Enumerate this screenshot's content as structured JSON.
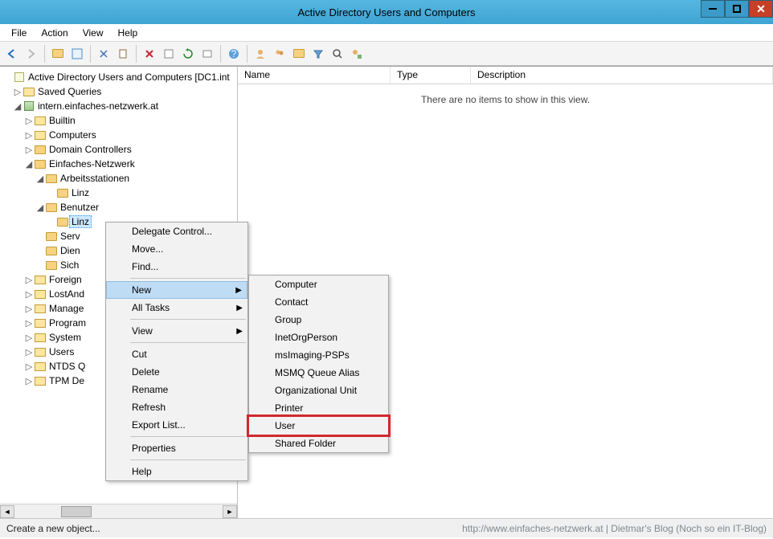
{
  "window": {
    "title": "Active Directory Users and Computers"
  },
  "menubar": {
    "file": "File",
    "action": "Action",
    "view": "View",
    "help": "Help"
  },
  "tree": {
    "root": "Active Directory Users and Computers [DC1.int",
    "saved": "Saved Queries",
    "domain": "intern.einfaches-netzwerk.at",
    "builtin": "Builtin",
    "computers": "Computers",
    "dc": "Domain Controllers",
    "en": "Einfaches-Netzwerk",
    "arbeit": "Arbeitsstationen",
    "linz1": "Linz",
    "benutzer": "Benutzer",
    "linz2": "Linz",
    "serv": "Serv",
    "dien": "Dien",
    "sich": "Sich",
    "foreign": "Foreign",
    "lost": "LostAnd",
    "manage": "Manage",
    "program": "Program",
    "system": "System",
    "users": "Users",
    "ntds": "NTDS Q",
    "tpm": "TPM De"
  },
  "list": {
    "col_name": "Name",
    "col_type": "Type",
    "col_desc": "Description",
    "empty": "There are no items to show in this view."
  },
  "context_menu": {
    "delegate": "Delegate Control...",
    "move": "Move...",
    "find": "Find...",
    "new": "New",
    "alltasks": "All Tasks",
    "view": "View",
    "cut": "Cut",
    "delete": "Delete",
    "rename": "Rename",
    "refresh": "Refresh",
    "export": "Export List...",
    "properties": "Properties",
    "help": "Help"
  },
  "new_submenu": {
    "computer": "Computer",
    "contact": "Contact",
    "group": "Group",
    "inetorg": "InetOrgPerson",
    "msimaging": "msImaging-PSPs",
    "msmq": "MSMQ Queue Alias",
    "ou": "Organizational Unit",
    "printer": "Printer",
    "user": "User",
    "shared": "Shared Folder"
  },
  "status": {
    "text": "Create a new object...",
    "blog": "http://www.einfaches-netzwerk.at | Dietmar's Blog (Noch so ein IT-Blog)"
  }
}
